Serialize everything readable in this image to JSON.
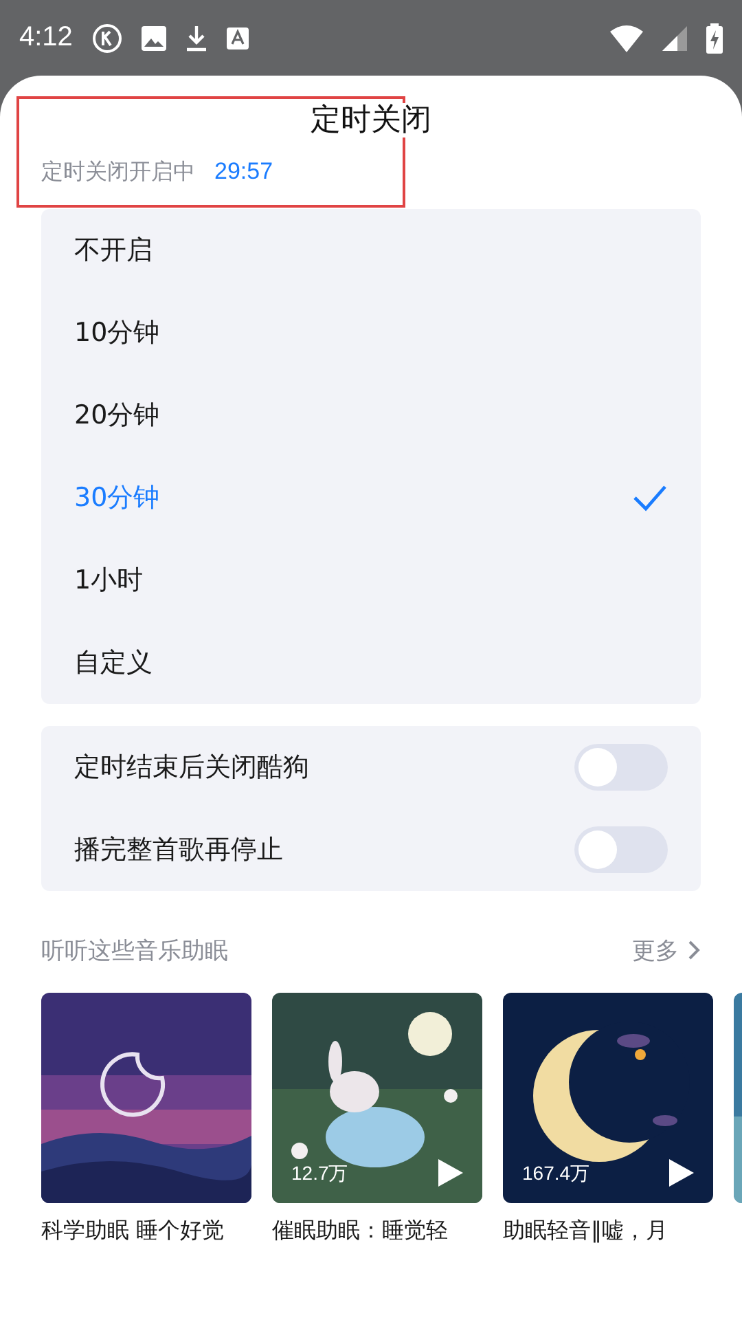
{
  "status_bar": {
    "time": "4:12"
  },
  "sheet": {
    "title": "定时关闭",
    "status_label": "定时关闭开启中",
    "countdown": "29:57"
  },
  "options": [
    {
      "label": "不开启",
      "selected": false
    },
    {
      "label": "10分钟",
      "selected": false
    },
    {
      "label": "20分钟",
      "selected": false
    },
    {
      "label": "30分钟",
      "selected": true
    },
    {
      "label": "1小时",
      "selected": false
    },
    {
      "label": "自定义",
      "selected": false
    }
  ],
  "switches": [
    {
      "label": "定时结束后关闭酷狗",
      "on": false
    },
    {
      "label": "播完整首歌再停止",
      "on": false
    }
  ],
  "section": {
    "title": "听听这些音乐助眠",
    "more": "更多"
  },
  "playlists": [
    {
      "title": "科学助眠 睡个好觉",
      "kind": "dusk"
    },
    {
      "title": "催眠助眠：睡觉轻",
      "plays": "12.7万",
      "kind": "meadow"
    },
    {
      "title": "助眠轻音‖嘘，月",
      "plays": "167.4万",
      "kind": "crescent"
    },
    {
      "kind": "edge"
    }
  ]
}
